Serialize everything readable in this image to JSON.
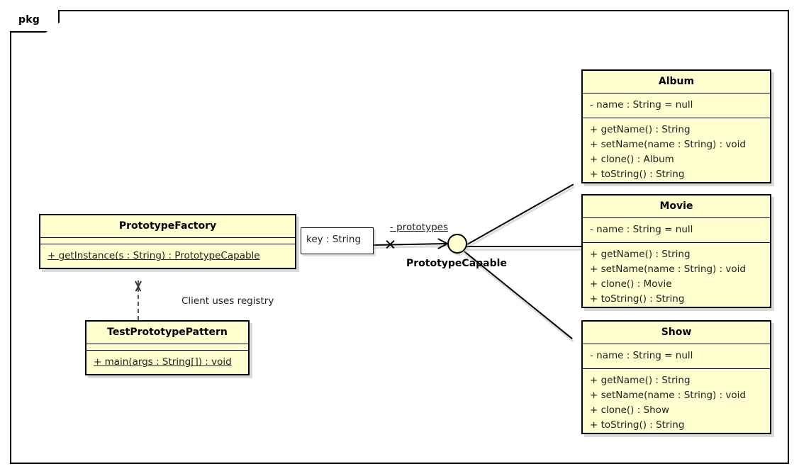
{
  "diagram": {
    "frame_label": "pkg",
    "type": "uml-class-diagram"
  },
  "classes": [
    {
      "id": "prototype-factory",
      "name": "PrototypeFactory",
      "attributes": [],
      "methods": [
        {
          "text": "+ getInstance(s : String) : PrototypeCapable",
          "static": true
        }
      ]
    },
    {
      "id": "test-prototype-pattern",
      "name": "TestPrototypePattern",
      "attributes": [],
      "methods": [
        {
          "text": "+ main(args : String[]) : void",
          "static": true
        }
      ]
    },
    {
      "id": "album",
      "name": "Album",
      "attributes": [
        {
          "text": "- name : String = null",
          "static": false
        }
      ],
      "methods": [
        {
          "text": "+ getName() : String",
          "static": false
        },
        {
          "text": "+ setName(name : String) : void",
          "static": false
        },
        {
          "text": "+ clone() : Album",
          "static": false
        },
        {
          "text": "+ toString() : String",
          "static": false
        }
      ]
    },
    {
      "id": "movie",
      "name": "Movie",
      "attributes": [
        {
          "text": "- name : String = null",
          "static": false
        }
      ],
      "methods": [
        {
          "text": "+ getName() : String",
          "static": false
        },
        {
          "text": "+ setName(name : String) : void",
          "static": false
        },
        {
          "text": "+ clone() : Movie",
          "static": false
        },
        {
          "text": "+ toString() : String",
          "static": false
        }
      ]
    },
    {
      "id": "show",
      "name": "Show",
      "attributes": [
        {
          "text": "- name : String = null",
          "static": false
        }
      ],
      "methods": [
        {
          "text": "+ getName() : String",
          "static": false
        },
        {
          "text": "+ setName(name : String) : void",
          "static": false
        },
        {
          "text": "+ clone() : Show",
          "static": false
        },
        {
          "text": "+ toString() : String",
          "static": false
        }
      ]
    }
  ],
  "interface": {
    "name": "PrototypeCapable"
  },
  "association": {
    "qualifier": "key : String",
    "role": "- prototypes"
  },
  "dependency": {
    "note": "Client uses registry"
  },
  "colors": {
    "class_fill": "#FEFECE",
    "border": "#000000",
    "qualifier_fill": "#FFFFFF",
    "shadow": "#AAAAAA",
    "text": "#222222",
    "dashed_line": "#555555"
  }
}
